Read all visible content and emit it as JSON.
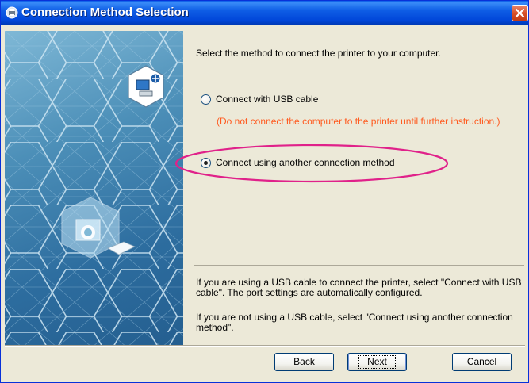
{
  "window": {
    "title": "Connection Method Selection",
    "title_icon": "printer-setup-icon",
    "close_icon": "close-icon"
  },
  "main": {
    "instruction": "Select the method to connect the printer to your computer.",
    "options": [
      {
        "label": "Connect with USB cable",
        "selected": false
      },
      {
        "label": "Connect using another connection method",
        "selected": true
      }
    ],
    "warning": "(Do not connect the computer to the printer until further instruction.)",
    "info_usb": "If you are using a USB cable to connect the printer, select \"Connect with USB cable\". The port settings are automatically configured.",
    "info_other": "If you are not using a USB cable, select \"Connect using another connection method\"."
  },
  "buttons": {
    "back_prefix": "B",
    "back_rest": "ack",
    "next_prefix": "N",
    "next_rest": "ext",
    "cancel": "Cancel"
  },
  "colors": {
    "titlebar": "#0054e3",
    "warning": "#ff5a1f",
    "highlight": "#e0218a",
    "panel": "#3a7fb0"
  }
}
